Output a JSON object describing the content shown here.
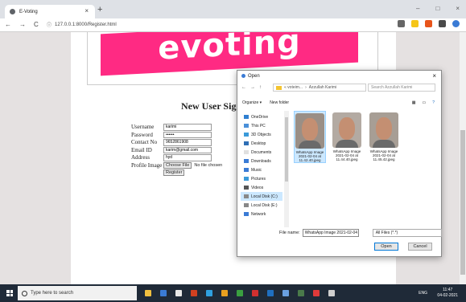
{
  "browser": {
    "tab_title": "E-Voting",
    "new_tab": "+",
    "url": "127.0.0.1:8000/Register.html",
    "controls": {
      "back": "←",
      "forward": "→",
      "reload": "C",
      "info": "ⓘ"
    },
    "window": {
      "minimize": "–",
      "maximize": "□",
      "close": "×"
    }
  },
  "banner": {
    "logo_text": "evoting"
  },
  "form": {
    "title": "New User Sig",
    "fields": [
      {
        "label": "Username",
        "value": "karimi"
      },
      {
        "label": "Password",
        "value": "••••••"
      },
      {
        "label": "Contact No",
        "value": "9652861908"
      },
      {
        "label": "Email ID",
        "value": "karim@gmail.com"
      },
      {
        "label": "Address",
        "value": "hyd"
      }
    ],
    "profile_label": "Profile Image",
    "choose_file": "Choose File",
    "no_file": "No file chosen",
    "register": "Register"
  },
  "dialog": {
    "title": "Open",
    "close": "×",
    "breadcrumb": [
      "« voteim...",
      "Azzullah Karimi"
    ],
    "search_placeholder": "Search Azzullah Karimi",
    "organize": "Organize ▾",
    "new_folder": "New folder",
    "sidebar": [
      {
        "label": "OneDrive",
        "color": "#2f7fd1"
      },
      {
        "label": "This PC",
        "color": "#4a90d9"
      },
      {
        "label": "3D Objects",
        "color": "#3a9ad9"
      },
      {
        "label": "Desktop",
        "color": "#2f6fb5"
      },
      {
        "label": "Documents",
        "color": "#e0e0e0"
      },
      {
        "label": "Downloads",
        "color": "#3a7bd5"
      },
      {
        "label": "Music",
        "color": "#3a7bd5"
      },
      {
        "label": "Pictures",
        "color": "#3a9ad9"
      },
      {
        "label": "Videos",
        "color": "#555555"
      },
      {
        "label": "Local Disk (C:)",
        "color": "#888888",
        "selected": true
      },
      {
        "label": "Local Disk (E:)",
        "color": "#888888"
      },
      {
        "label": "Network",
        "color": "#3a7bd5"
      }
    ],
    "files": [
      {
        "name": "WhatsApp Image 2021-02-04 at 11.42.40.jpeg",
        "bg": "#9a8f86",
        "selected": true
      },
      {
        "name": "WhatsApp Image 2021-02-04 at 11.44.40.jpeg",
        "bg": "#b3aaa2"
      },
      {
        "name": "WhatsApp Image 2021-02-04 at 11.45.42.jpeg",
        "bg": "#a79e95"
      }
    ],
    "file_name_label": "File name:",
    "file_name_value": "WhatsApp Image 2021-02-04 at 11",
    "filter": "All Files (*.*)",
    "open": "Open",
    "cancel": "Cancel"
  },
  "taskbar": {
    "search_text": "Type here to search",
    "time": "11:47",
    "date": "04-02-2021",
    "tray": "ENG",
    "app_colors": [
      "#f0c040",
      "#3a7bd5",
      "#e8e8e8",
      "#d04020",
      "#2fa0e0",
      "#e8a020",
      "#3aa040",
      "#d03030",
      "#1f6fc0",
      "#6aa0e0",
      "#4a7a4a",
      "#e03a3a",
      "#cfcfcf"
    ]
  }
}
